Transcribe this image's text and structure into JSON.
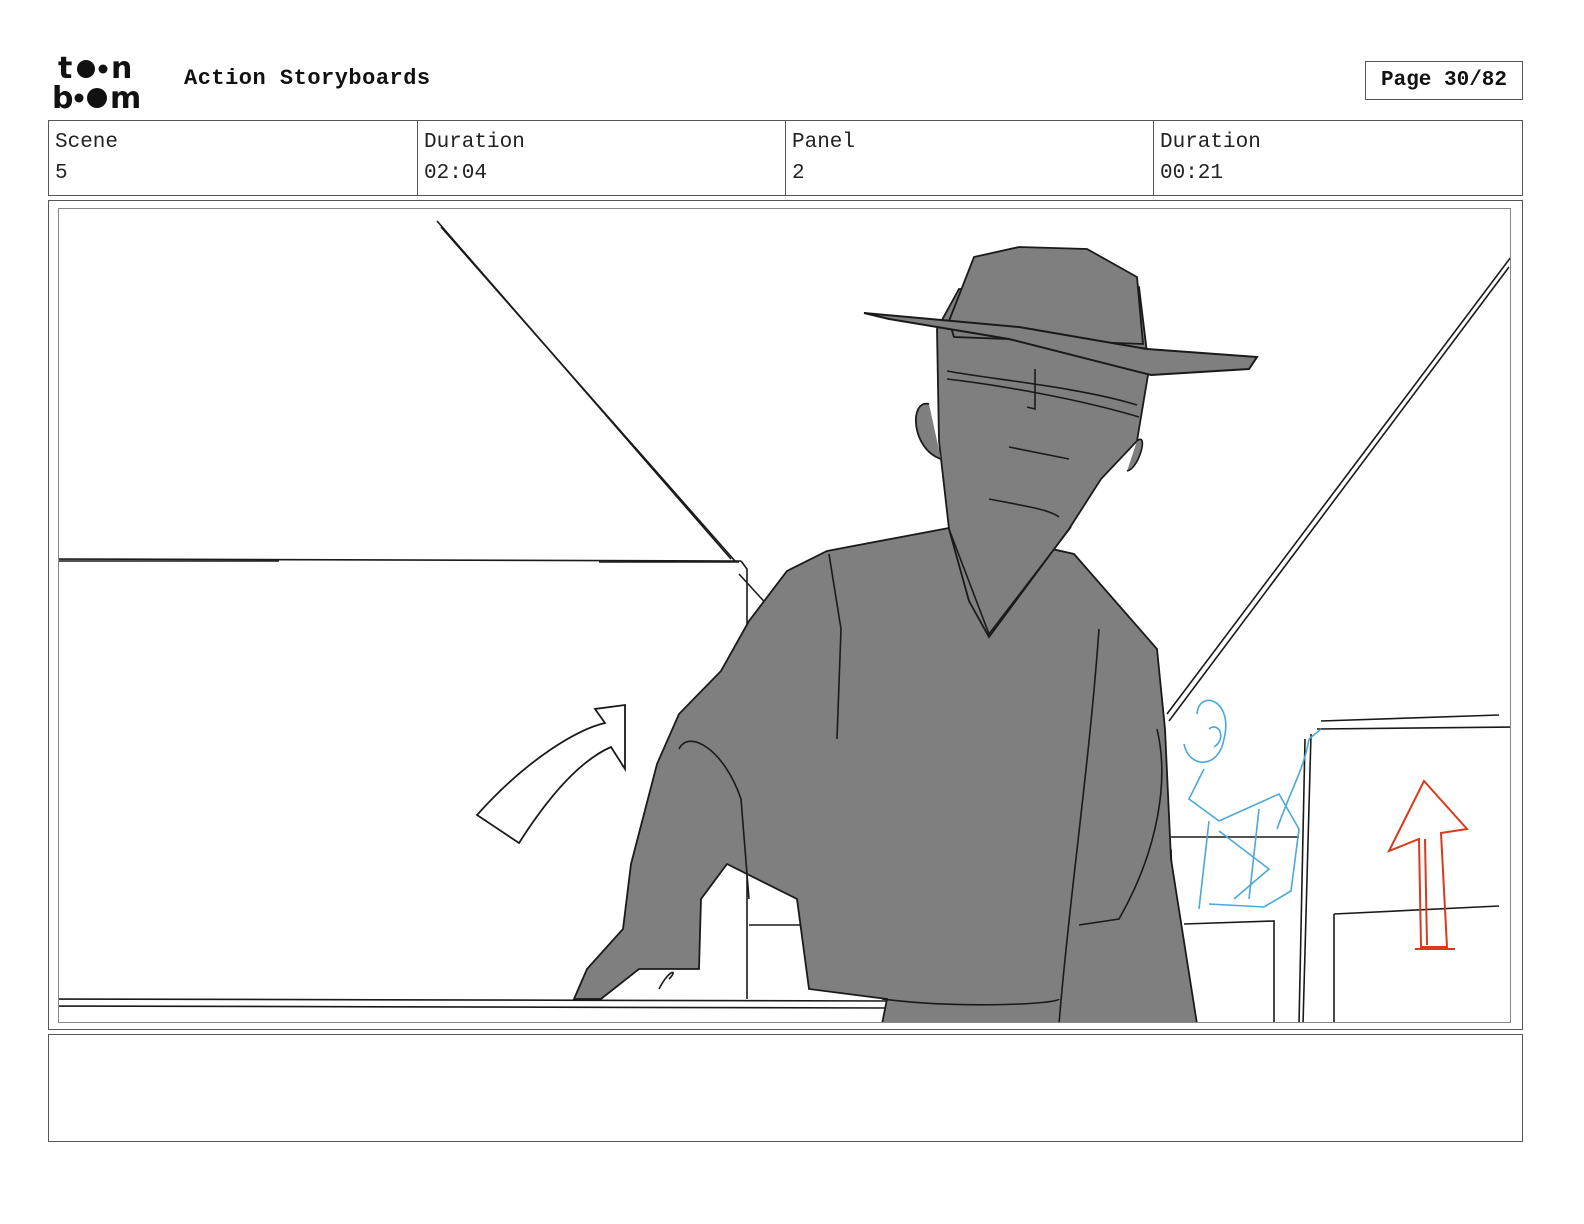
{
  "header": {
    "logo_text": "toon boom",
    "title": "Action Storyboards",
    "page_label": "Page 30/82"
  },
  "info": {
    "scene_label": "Scene",
    "scene_value": "5",
    "scene_duration_label": "Duration",
    "scene_duration_value": "02:04",
    "panel_label": "Panel",
    "panel_value": "2",
    "panel_duration_label": "Duration",
    "panel_duration_value": "00:21"
  },
  "panel_image": {
    "description_icons": [
      "man-with-hat-silhouette",
      "curved-arrow-icon",
      "up-arrow-icon",
      "background-figure-sketch"
    ],
    "colors": {
      "silhouette": "#7f7f7f",
      "line": "#1a1a1a",
      "blue_sketch": "#4aa8dc",
      "red_arrow": "#d93a1a"
    }
  },
  "notes": {
    "text": ""
  }
}
